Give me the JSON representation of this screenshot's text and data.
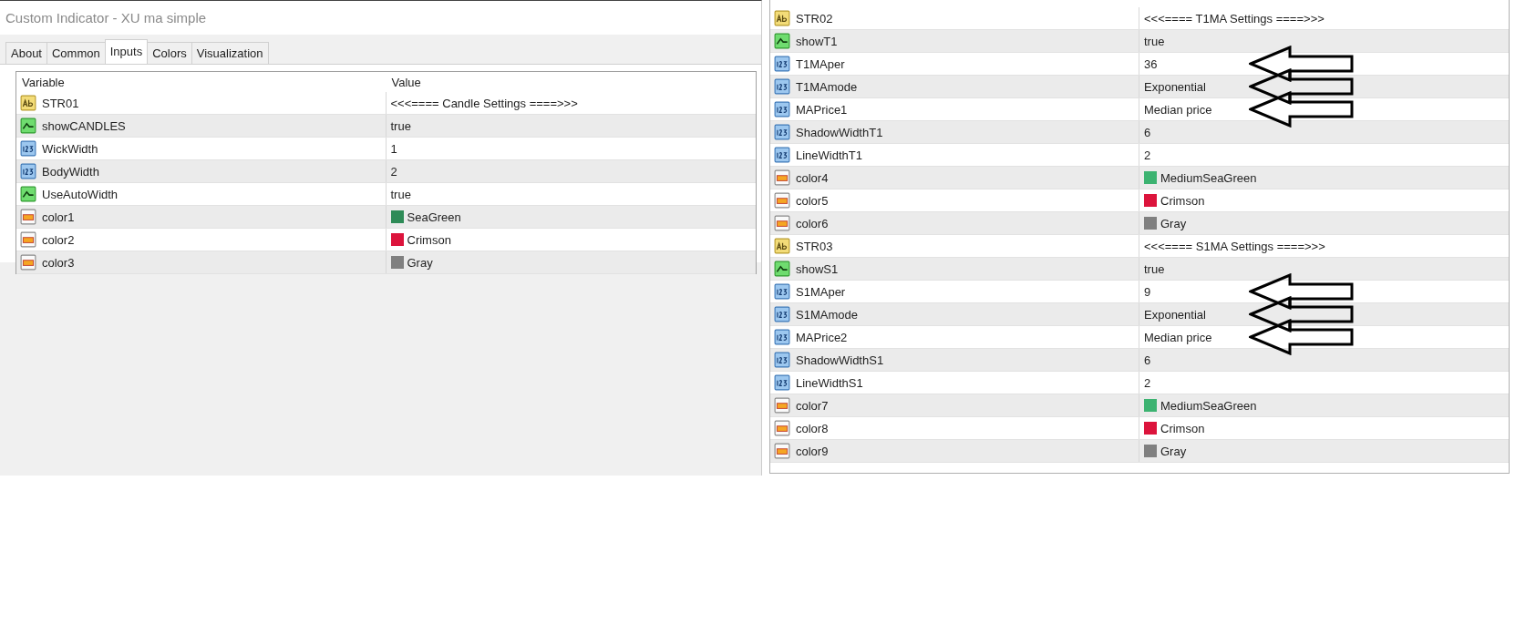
{
  "window": {
    "title": "Custom Indicator - XU ma simple"
  },
  "tabs": [
    {
      "label": "About",
      "selected": false
    },
    {
      "label": "Common",
      "selected": false
    },
    {
      "label": "Inputs",
      "selected": true
    },
    {
      "label": "Colors",
      "selected": false
    },
    {
      "label": "Visualization",
      "selected": false
    }
  ],
  "table": {
    "columns": [
      "Variable",
      "Value"
    ],
    "rows": [
      {
        "kind": "string",
        "variable": "STR01",
        "value": "<<<====  Candle Settings ====>>>"
      },
      {
        "kind": "bool",
        "variable": "showCANDLES",
        "value": "true"
      },
      {
        "kind": "int",
        "variable": "WickWidth",
        "value": "1"
      },
      {
        "kind": "int",
        "variable": "BodyWidth",
        "value": "2"
      },
      {
        "kind": "bool",
        "variable": "UseAutoWidth",
        "value": "true"
      },
      {
        "kind": "color",
        "variable": "color1",
        "value": "SeaGreen",
        "color": "#2e8b57"
      },
      {
        "kind": "color",
        "variable": "color2",
        "value": "Crimson",
        "color": "#dc143c"
      },
      {
        "kind": "color",
        "variable": "color3",
        "value": "Gray",
        "color": "#808080"
      }
    ]
  },
  "continued_table": {
    "rows": [
      {
        "kind": "string",
        "variable": "STR02",
        "value": "<<<====  T1MA Settings ====>>>"
      },
      {
        "kind": "bool",
        "variable": "showT1",
        "value": "true"
      },
      {
        "kind": "int",
        "variable": "T1MAper",
        "value": "36",
        "arrow": true
      },
      {
        "kind": "int",
        "variable": "T1MAmode",
        "value": "Exponential",
        "arrow": true
      },
      {
        "kind": "int",
        "variable": "MAPrice1",
        "value": "Median price",
        "arrow": true
      },
      {
        "kind": "int",
        "variable": "ShadowWidthT1",
        "value": "6"
      },
      {
        "kind": "int",
        "variable": "LineWidthT1",
        "value": "2"
      },
      {
        "kind": "color",
        "variable": "color4",
        "value": "MediumSeaGreen",
        "color": "#3cb371"
      },
      {
        "kind": "color",
        "variable": "color5",
        "value": "Crimson",
        "color": "#dc143c"
      },
      {
        "kind": "color",
        "variable": "color6",
        "value": "Gray",
        "color": "#808080"
      },
      {
        "kind": "string",
        "variable": "STR03",
        "value": "<<<====  S1MA Settings ====>>>"
      },
      {
        "kind": "bool",
        "variable": "showS1",
        "value": "true"
      },
      {
        "kind": "int",
        "variable": "S1MAper",
        "value": "9",
        "arrow": true
      },
      {
        "kind": "int",
        "variable": "S1MAmode",
        "value": "Exponential",
        "arrow": true
      },
      {
        "kind": "int",
        "variable": "MAPrice2",
        "value": "Median price",
        "arrow": true
      },
      {
        "kind": "int",
        "variable": "ShadowWidthS1",
        "value": "6"
      },
      {
        "kind": "int",
        "variable": "LineWidthS1",
        "value": "2"
      },
      {
        "kind": "color",
        "variable": "color7",
        "value": "MediumSeaGreen",
        "color": "#3cb371"
      },
      {
        "kind": "color",
        "variable": "color8",
        "value": "Crimson",
        "color": "#dc143c"
      },
      {
        "kind": "color",
        "variable": "color9",
        "value": "Gray",
        "color": "#808080"
      }
    ]
  }
}
